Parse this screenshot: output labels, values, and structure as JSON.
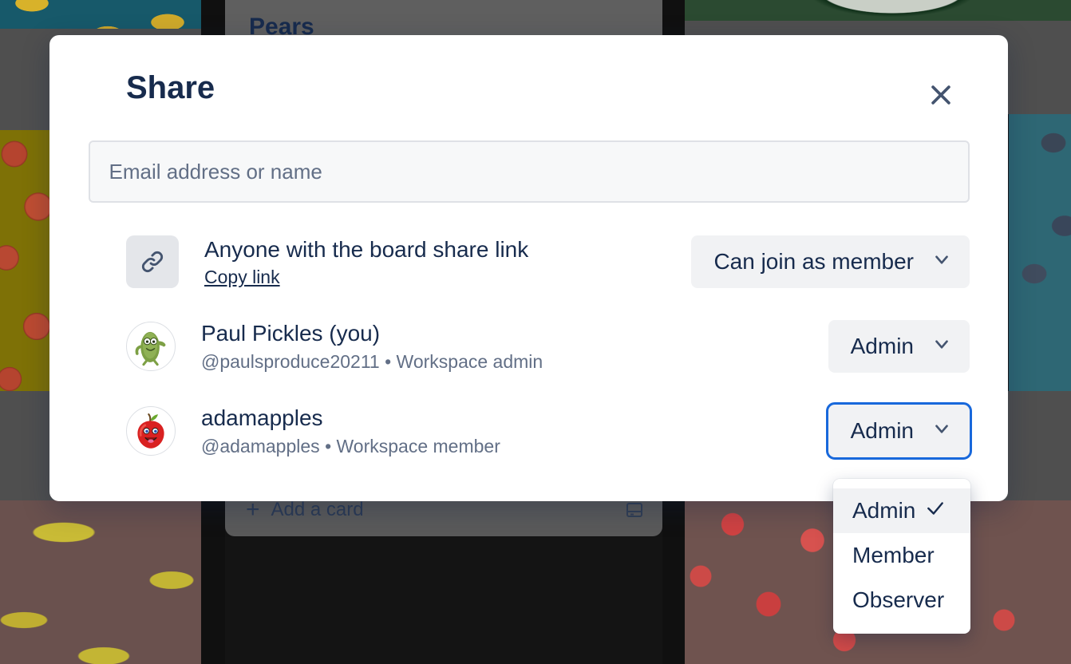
{
  "board": {
    "list_title": "Pears",
    "add_card_label": "Add a card",
    "add_card_icon": "plus-icon",
    "card_template_icon": "card-template-icon",
    "background_tiles": [
      {
        "name": "lemons-tile",
        "subject": "lemons",
        "bg_color": "#17596a"
      },
      {
        "name": "apples-tile",
        "subject": "apples",
        "bg_color": "#7e7106"
      },
      {
        "name": "bananas-tile",
        "subject": "bananas",
        "bg_color": "#6a514e"
      },
      {
        "name": "green-arc-tile",
        "subject": "avocado",
        "bg_color": "#2b4a31"
      },
      {
        "name": "blueberries-tile",
        "subject": "blueberries",
        "bg_color": "#2e6774"
      },
      {
        "name": "strawberries-tile",
        "subject": "strawberries",
        "bg_color": "#6f534f"
      }
    ]
  },
  "modal": {
    "title": "Share",
    "close_icon": "close-icon",
    "invite": {
      "placeholder": "Email address or name",
      "value": ""
    },
    "share_link_row": {
      "icon": "link-icon",
      "title": "Anyone with the board share link",
      "copy_link_label": "Copy link",
      "role_label": "Can join as member",
      "chevron_icon": "chevron-down-icon"
    },
    "members": [
      {
        "avatar": "pickle-avatar",
        "name": "Paul Pickles (you)",
        "handle": "@paulsproduce20211",
        "separator": "•",
        "workspace_role": "Workspace admin",
        "role_label": "Admin",
        "chevron_icon": "chevron-down-icon",
        "focused": false
      },
      {
        "avatar": "apple-avatar",
        "name": "adamapples",
        "handle": "@adamapples",
        "separator": "•",
        "workspace_role": "Workspace member",
        "role_label": "Admin",
        "chevron_icon": "chevron-down-icon",
        "focused": true
      }
    ],
    "role_menu": {
      "open": true,
      "items": [
        {
          "label": "Admin",
          "selected": true,
          "check_icon": "check-icon"
        },
        {
          "label": "Member",
          "selected": false
        },
        {
          "label": "Observer",
          "selected": false
        }
      ]
    }
  },
  "colors": {
    "modal_bg": "#ffffff",
    "text_primary": "#172b4d",
    "text_subtle": "#626f86",
    "control_bg": "#f1f2f4",
    "input_bg": "#f7f8f9",
    "input_border": "#dfe1e6",
    "focus_ring": "#1868db",
    "menu_selected_bg": "#f1f2f4"
  }
}
